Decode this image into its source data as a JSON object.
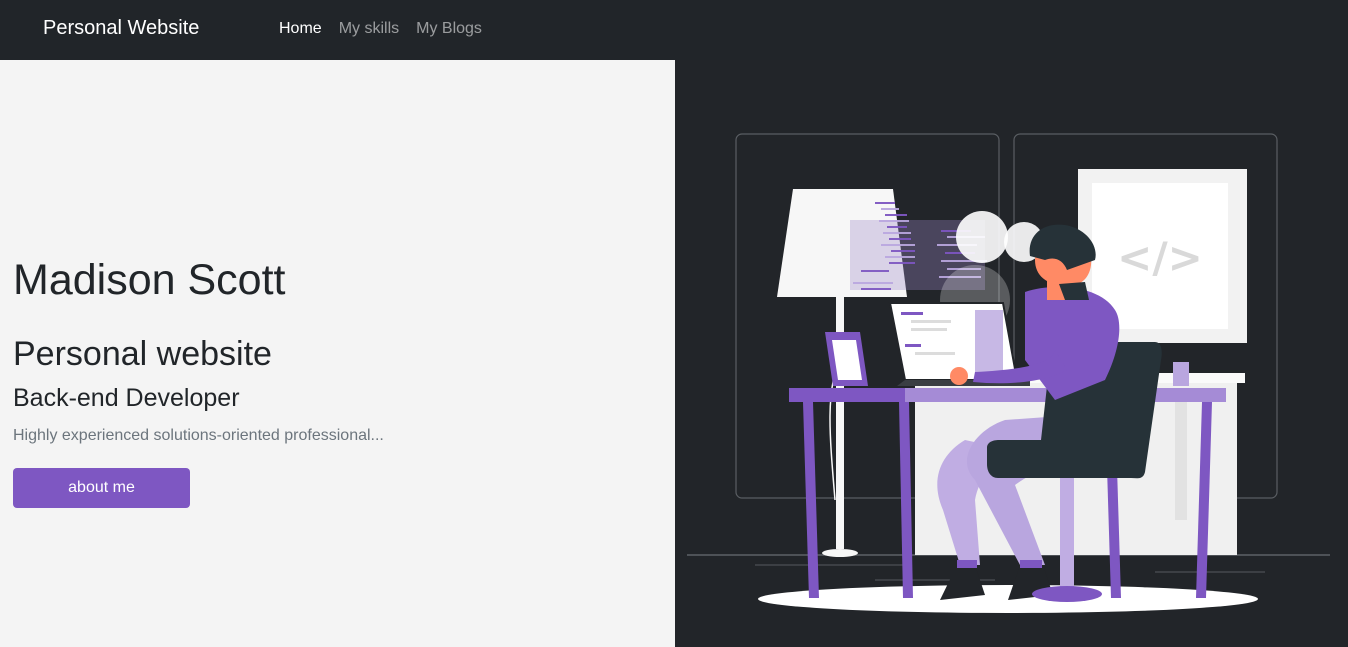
{
  "navbar": {
    "brand": "Personal Website",
    "links": [
      {
        "label": "Home",
        "active": true
      },
      {
        "label": "My skills",
        "active": false
      },
      {
        "label": "My Blogs",
        "active": false
      }
    ]
  },
  "hero": {
    "name": "Madison Scott",
    "subtitle": "Personal website",
    "role": "Back-end Developer",
    "description": "Highly experienced solutions-oriented professional...",
    "button_label": "about me"
  },
  "illustration": {
    "code_glyph": "</>"
  },
  "colors": {
    "navbar_bg": "#212529",
    "left_bg": "#f4f4f4",
    "right_bg": "#222529",
    "accent": "#7e57c2"
  }
}
